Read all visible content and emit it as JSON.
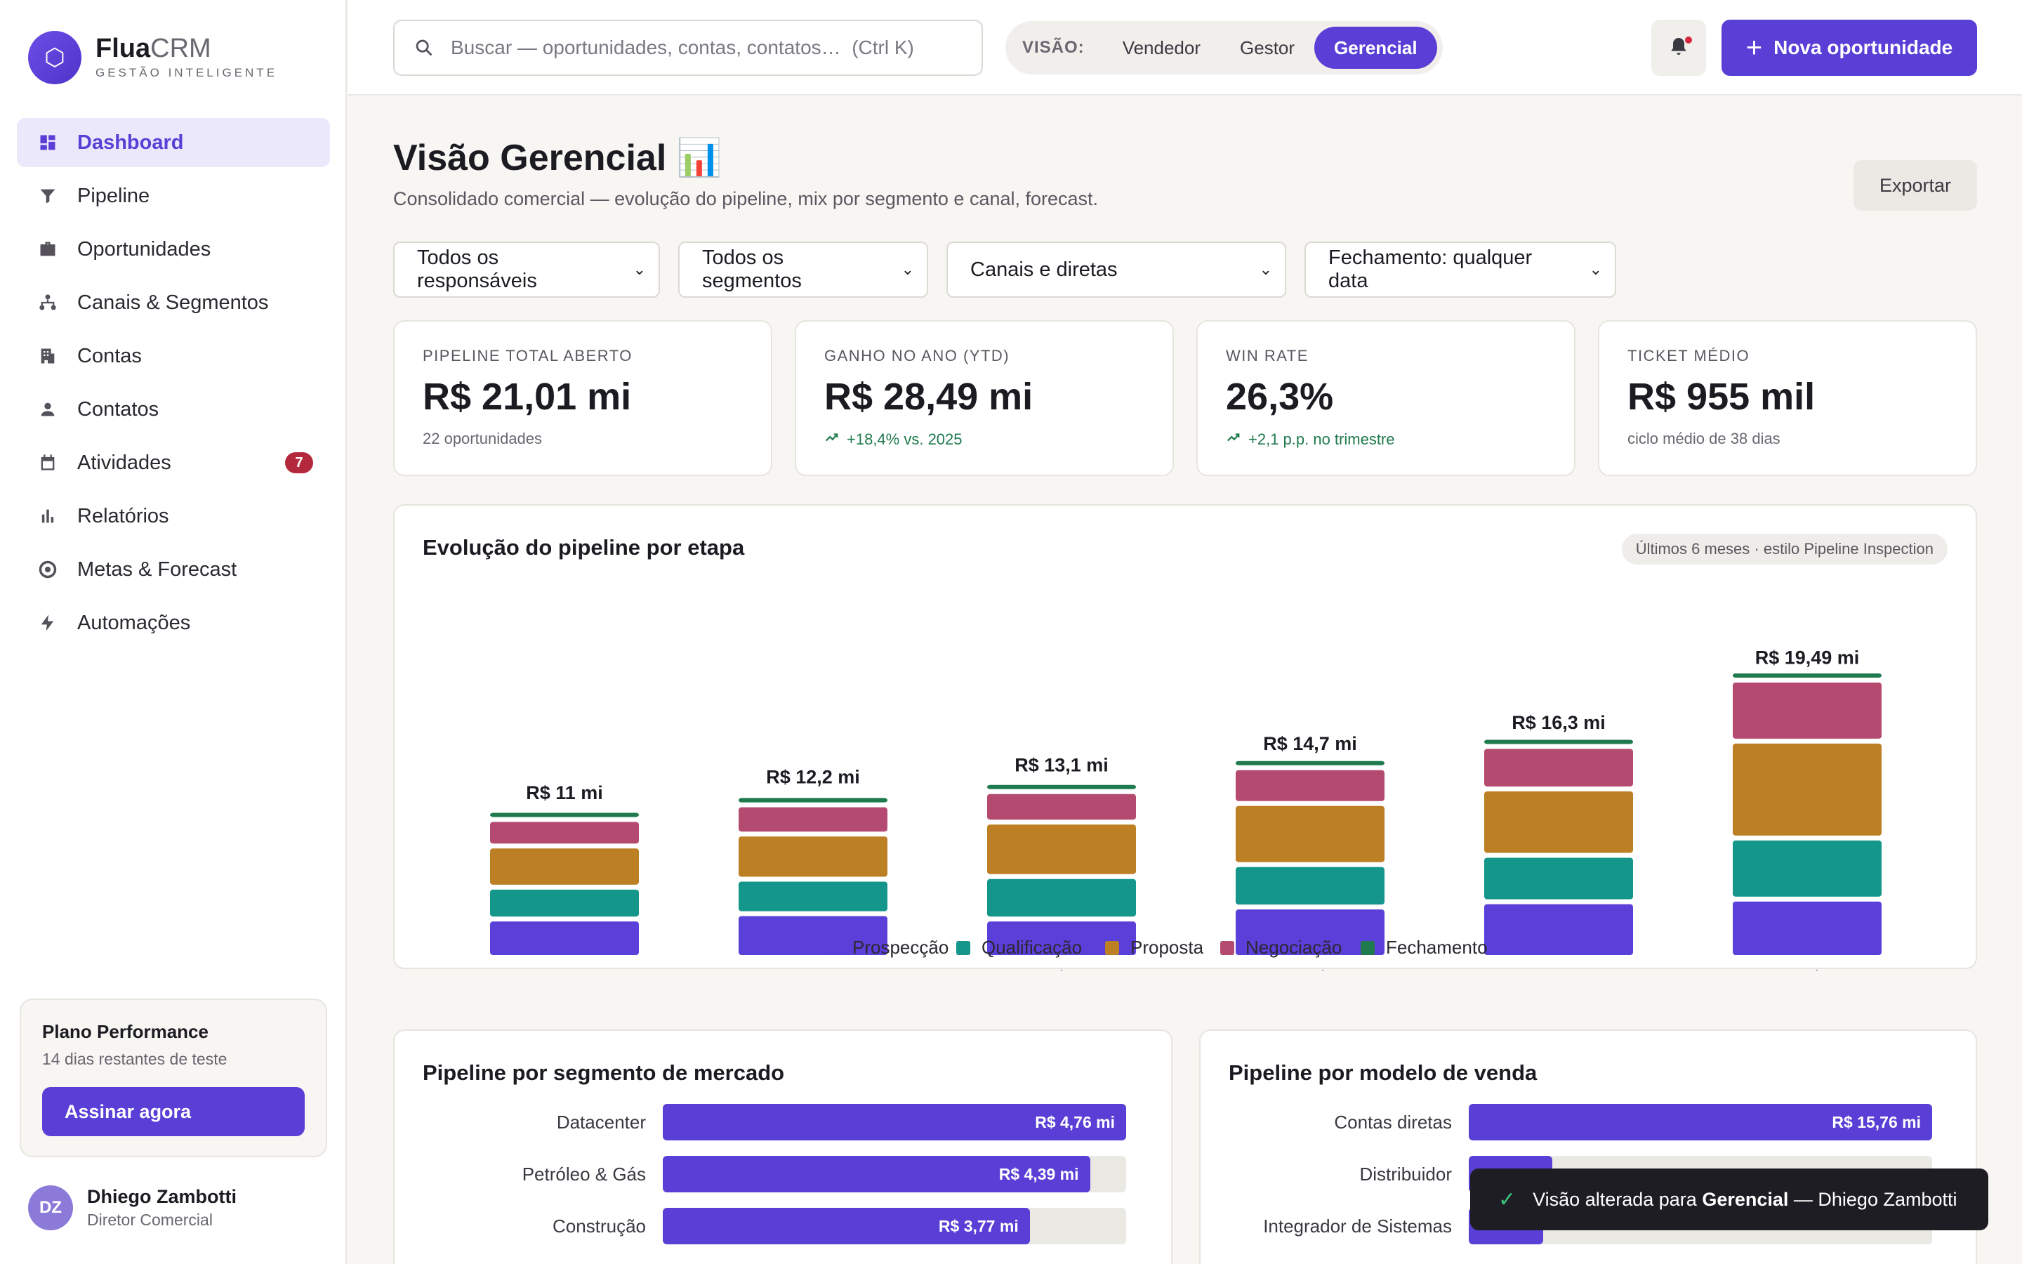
{
  "brand": {
    "name": "Flua",
    "name_light": "CRM",
    "tagline": "GESTÃO INTELIGENTE",
    "logo_glyph": "⬡"
  },
  "nav": [
    {
      "label": "Dashboard",
      "icon": "dashboard-icon",
      "active": true
    },
    {
      "label": "Pipeline",
      "icon": "funnel-icon"
    },
    {
      "label": "Oportunidades",
      "icon": "briefcase-icon"
    },
    {
      "label": "Canais & Segmentos",
      "icon": "hierarchy-icon"
    },
    {
      "label": "Contas",
      "icon": "building-icon"
    },
    {
      "label": "Contatos",
      "icon": "person-icon"
    },
    {
      "label": "Atividades",
      "icon": "calendar-icon",
      "badge": "7"
    },
    {
      "label": "Relatórios",
      "icon": "bar-chart-icon"
    },
    {
      "label": "Metas & Forecast",
      "icon": "target-icon"
    },
    {
      "label": "Automações",
      "icon": "bolt-icon"
    }
  ],
  "plan": {
    "title": "Plano Performance",
    "subtitle": "14 dias restantes de teste",
    "cta": "Assinar agora"
  },
  "user": {
    "initials": "DZ",
    "name": "Dhiego Zambotti",
    "role": "Diretor Comercial"
  },
  "topbar": {
    "search_placeholder": "Buscar — oportunidades, contas, contatos…  (Ctrl K)",
    "view_label": "VISÃO:",
    "views": [
      "Vendedor",
      "Gestor",
      "Gerencial"
    ],
    "active_view": "Gerencial",
    "new_button": "Nova oportunidade"
  },
  "page": {
    "title": "Visão Gerencial 📊",
    "subtitle": "Consolidado comercial — evolução do pipeline, mix por segmento e canal, forecast.",
    "export": "Exportar"
  },
  "filters": [
    "Todos os responsáveis",
    "Todos os segmentos",
    "Canais e diretas",
    "Fechamento: qualquer data"
  ],
  "kpis": [
    {
      "label": "PIPELINE TOTAL ABERTO",
      "value": "R$ 21,01 mi",
      "note": "22 oportunidades",
      "trend": false
    },
    {
      "label": "GANHO NO ANO (YTD)",
      "value": "R$ 28,49 mi",
      "note": "+18,4% vs. 2025",
      "trend": true
    },
    {
      "label": "WIN RATE",
      "value": "26,3%",
      "note": "+2,1 p.p. no trimestre",
      "trend": true
    },
    {
      "label": "TICKET MÉDIO",
      "value": "R$ 955 mil",
      "note": "ciclo médio de 38 dias",
      "trend": false
    }
  ],
  "chart": {
    "title": "Evolução do pipeline por etapa",
    "chip": "Últimos 6 meses · estilo Pipeline Inspection"
  },
  "chart_data": {
    "type": "bar",
    "stacked": true,
    "categories": [
      "Fev",
      "Mar",
      "Abr",
      "Mai",
      "Jun",
      "Jul"
    ],
    "totals": [
      "R$ 11 mi",
      "R$ 12,2 mi",
      "R$ 13,1 mi",
      "R$ 14,7 mi",
      "R$ 16,3 mi",
      "R$ 19,49 mi"
    ],
    "series": [
      {
        "name": "Prospecção",
        "color": "#5b3fd9",
        "values": [
          2.9,
          3.3,
          2.9,
          3.8,
          4.2,
          4.4
        ]
      },
      {
        "name": "Qualificação",
        "color": "#14968a",
        "values": [
          2.4,
          2.6,
          3.2,
          3.2,
          3.5,
          4.6
        ]
      },
      {
        "name": "Proposta",
        "color": "#bd7f24",
        "values": [
          3.1,
          3.4,
          4.1,
          4.6,
          5.0,
          7.3
        ]
      },
      {
        "name": "Negociação",
        "color": "#b54a70",
        "values": [
          2.0,
          2.2,
          2.3,
          2.7,
          3.2,
          4.6
        ]
      },
      {
        "name": "Fechamento",
        "color": "#1f7a4d",
        "values": [
          0.6,
          0.7,
          0.6,
          0.4,
          0.4,
          0.3
        ]
      }
    ]
  },
  "segments": {
    "title": "Pipeline por segmento de mercado",
    "rows": [
      {
        "label": "Datacenter",
        "value": "R$ 4,76 mi",
        "fraction": 1.0
      },
      {
        "label": "Petróleo & Gás",
        "value": "R$ 4,39 mi",
        "fraction": 0.922
      },
      {
        "label": "Construção",
        "value": "R$ 3,77 mi",
        "fraction": 0.792
      }
    ]
  },
  "models": {
    "title": "Pipeline por modelo de venda",
    "rows": [
      {
        "label": "Contas diretas",
        "value": "R$ 15,76 mi",
        "fraction": 1.0
      },
      {
        "label": "Distribuidor",
        "value": "",
        "fraction": 0.18
      },
      {
        "label": "Integrador de Sistemas",
        "value": "",
        "fraction": 0.16
      }
    ]
  },
  "toast": {
    "prefix": "Visão alterada para ",
    "bold": "Gerencial",
    "suffix": " — Dhiego Zambotti"
  }
}
